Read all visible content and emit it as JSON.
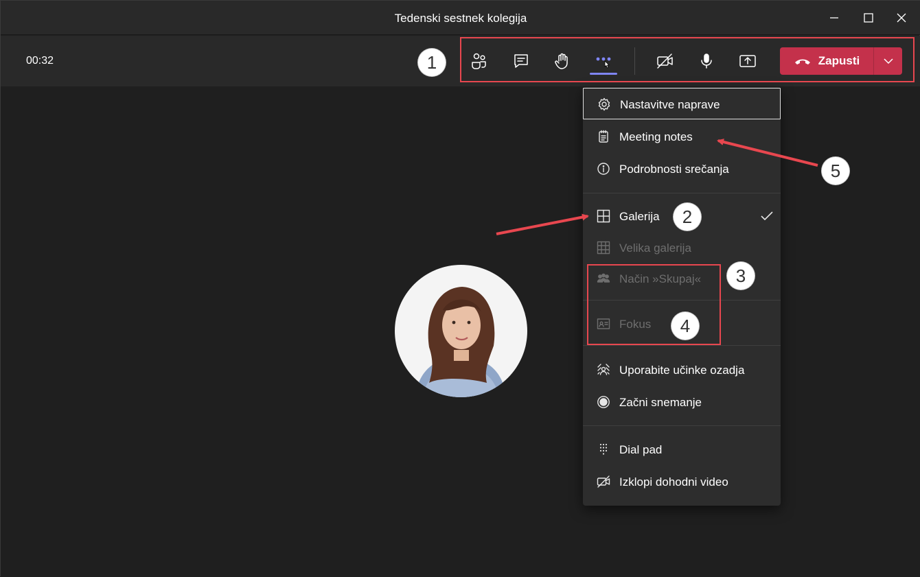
{
  "window": {
    "title": "Tedenski sestnek kolegija"
  },
  "toolbar": {
    "timer": "00:32",
    "leave_label": "Zapusti"
  },
  "menu": {
    "items": [
      {
        "label": "Nastavitve naprave",
        "icon": "gear-icon"
      },
      {
        "label": "Meeting notes",
        "icon": "notes-icon"
      },
      {
        "label": "Podrobnosti srečanja",
        "icon": "info-icon"
      },
      {
        "label": "Galerija",
        "icon": "gallery-icon",
        "checked": true
      },
      {
        "label": "Velika galerija",
        "icon": "large-gallery-icon",
        "disabled": true
      },
      {
        "label": "Način »Skupaj«",
        "icon": "together-mode-icon",
        "disabled": true
      },
      {
        "label": "Fokus",
        "icon": "focus-icon",
        "disabled": true
      },
      {
        "label": "Uporabite učinke ozadja",
        "icon": "background-effects-icon"
      },
      {
        "label": "Začni snemanje",
        "icon": "record-icon"
      },
      {
        "label": "Dial pad",
        "icon": "dialpad-icon"
      },
      {
        "label": "Izklopi dohodni video",
        "icon": "video-off-icon"
      }
    ]
  },
  "callouts": [
    "1",
    "2",
    "3",
    "4",
    "5"
  ],
  "colors": {
    "accent": "#7f85f5",
    "leave": "#c4314b",
    "annotation": "#e8474f"
  }
}
